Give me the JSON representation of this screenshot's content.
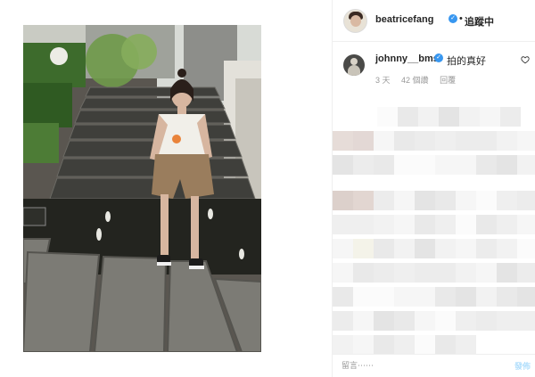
{
  "header": {
    "username": "beatricefang",
    "separator": "•",
    "follow_status": "追蹤中"
  },
  "comment": {
    "username": "johnny__bms",
    "text": "拍的真好",
    "time_ago": "3 天",
    "likes": "42 個讚",
    "reply_label": "回覆"
  },
  "footer": {
    "placeholder": "留言⋯⋯",
    "post_label": "發佈"
  },
  "colors": {
    "verified": "#3897f0",
    "meta_text": "#999999",
    "post_disabled": "#b2dffc"
  },
  "icons": {
    "verified": "verified-badge-icon",
    "like": "heart-icon"
  }
}
